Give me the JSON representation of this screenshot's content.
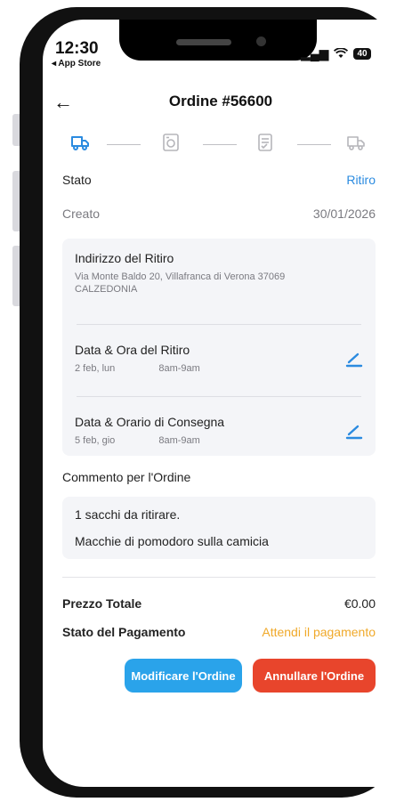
{
  "status_bar": {
    "time": "12:30",
    "source": "◂ App Store",
    "battery": "40"
  },
  "header": {
    "back_icon": "arrow-left-icon",
    "title": "Ordine #56600"
  },
  "progress": {
    "icons": [
      "delivery-van-icon",
      "washing-machine-icon",
      "checklist-icon",
      "delivery-truck-icon"
    ],
    "active_color": "#2b8be0",
    "inactive_color": "#b5b5ba"
  },
  "order": {
    "status_label": "Stato",
    "status_value": "Ritiro",
    "created_label": "Creato",
    "created_value": "30/01/2026"
  },
  "details_card": {
    "pickup_address_title": "Indirizzo del Ritiro",
    "pickup_address_line1": "Via Monte Baldo 20, Villafranca di Verona 37069",
    "pickup_address_line2": "CALZEDONIA",
    "pickup_time_title": "Data & Ora del Ritiro",
    "pickup_date": "2 feb, lun",
    "pickup_slot": "8am-9am",
    "delivery_time_title": "Data & Orario di Consegna",
    "delivery_date": "5 feb, gio",
    "delivery_slot": "8am-9am"
  },
  "comment": {
    "label": "Commento per l'Ordine",
    "lines": [
      "1 sacchi da ritirare.",
      "Macchie di pomodoro sulla camicia"
    ]
  },
  "summary": {
    "total_label": "Prezzo Totale",
    "total_value": "€0.00",
    "payment_label": "Stato del Pagamento",
    "payment_value": "Attendi il pagamento"
  },
  "actions": {
    "modify_label": "Modificare l'Ordine",
    "cancel_label": "Annullare l'Ordine"
  },
  "colors": {
    "accent": "#2b8be0",
    "payment_pending": "#f0a92a",
    "cancel": "#e8452c",
    "modify": "#2aa3ea"
  }
}
